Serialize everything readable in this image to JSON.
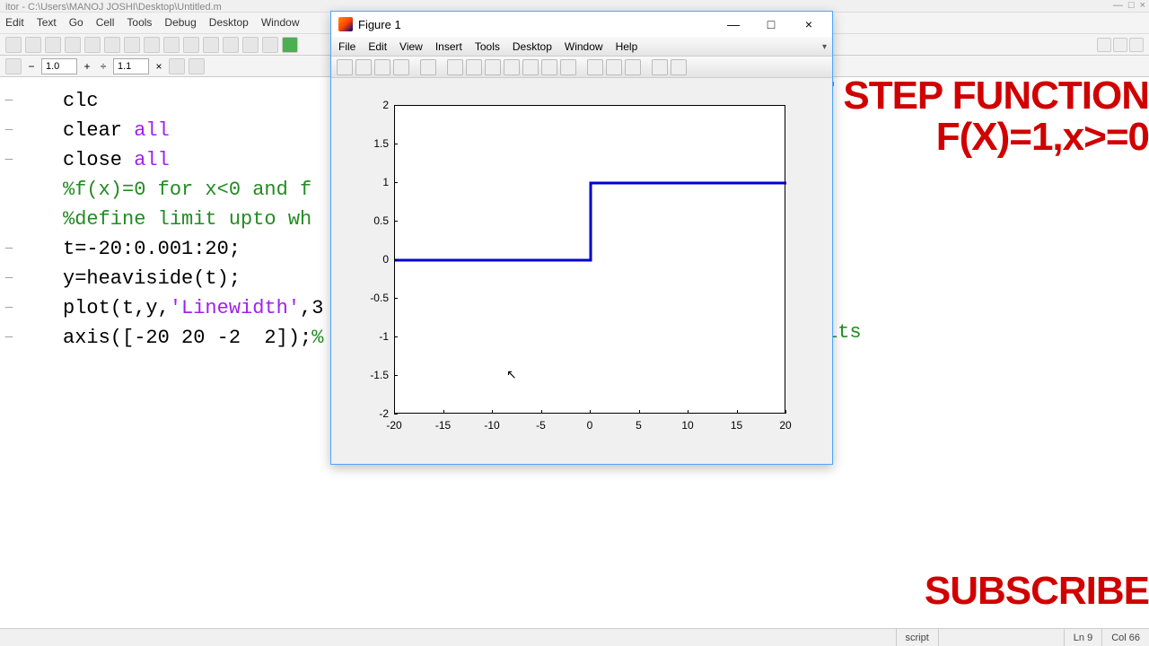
{
  "app": {
    "title": "itor - C:\\Users\\MANOJ JOSHI\\Desktop\\Untitled.m",
    "menus": [
      "Edit",
      "Text",
      "Go",
      "Cell",
      "Tools",
      "Debug",
      "Desktop",
      "Window"
    ],
    "toolbar2": {
      "zoom_out": "1.0",
      "zoom_in": "1.1"
    }
  },
  "code": {
    "lines": [
      {
        "t": "clc",
        "cls": ""
      },
      {
        "t": "clear",
        "sp": " ",
        "arg": "all"
      },
      {
        "t": "close",
        "sp": " ",
        "arg": "all"
      },
      {
        "cmt": "%f(x)=0 for x<0 and f"
      },
      {
        "cmt": "%define limit upto wh"
      },
      {
        "plain": "t=-20:0.001:20;"
      },
      {
        "plain": "y=heaviside(t);"
      },
      {
        "call": "plot(t,y,",
        "str": "'Linewidth'",
        "tail": ",3"
      },
      {
        "plain": "axis([-20 20 -2  2]);",
        "tailcmt": "%"
      }
    ],
    "truncated_comment": "its"
  },
  "figure": {
    "title": "Figure 1",
    "menus": [
      "File",
      "Edit",
      "View",
      "Insert",
      "Tools",
      "Desktop",
      "Window",
      "Help"
    ]
  },
  "chart_data": {
    "type": "line",
    "x": [
      -20,
      0,
      0,
      20
    ],
    "y": [
      0,
      0,
      1,
      1
    ],
    "xlim": [
      -20,
      20
    ],
    "ylim": [
      -2,
      2
    ],
    "xticks": [
      -20,
      -15,
      -10,
      -5,
      0,
      5,
      10,
      15,
      20
    ],
    "yticks": [
      -2,
      -1.5,
      -1,
      -0.5,
      0,
      0.5,
      1,
      1.5,
      2
    ],
    "xlabel": "",
    "ylabel": "",
    "title": ""
  },
  "overlay": {
    "title": "UNIT STEP FUNCTION",
    "equation": "F(X)=1,x>=0",
    "subscribe": "SUBSCRIBE"
  },
  "status": {
    "type": "script",
    "ln": "Ln  9",
    "col": "Col  66"
  }
}
